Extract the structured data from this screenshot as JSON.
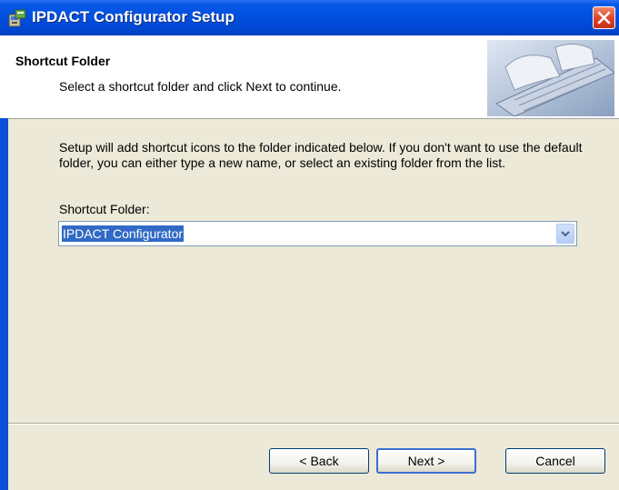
{
  "window": {
    "title": "IPDACT Configurator Setup",
    "close_icon": "close-icon",
    "app_icon": "installer-icon"
  },
  "header": {
    "title": "Shortcut Folder",
    "subtitle": "Select a shortcut folder and click Next to continue.",
    "image": "keyboard-hands-image"
  },
  "body": {
    "description": "Setup will add shortcut icons to the folder indicated below. If you don't want to use the default folder, you can either type a new name, or select an existing folder from the list.",
    "field_label": "Shortcut Folder:",
    "field_value": "IPDACT Configurator",
    "dropdown_icon": "chevron-down-icon"
  },
  "buttons": {
    "back": "< Back",
    "next": "Next >",
    "cancel": "Cancel"
  },
  "colors": {
    "titlebar": "#0050e0",
    "face": "#ece9d8",
    "selection": "#316ac5",
    "close": "#e0462a"
  }
}
